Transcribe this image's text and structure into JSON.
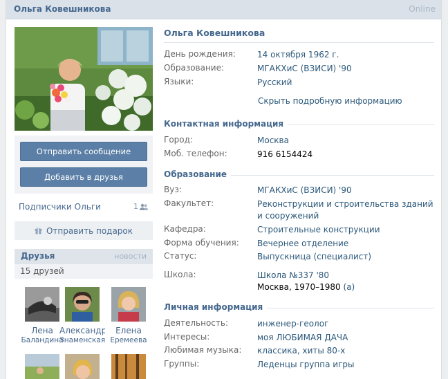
{
  "header": {
    "name": "Ольга Ковешникова",
    "status": "Online"
  },
  "actions": {
    "send_message": "Отправить сообщение",
    "add_friend": "Добавить в друзья",
    "followers_label": "Подписчики Ольги",
    "followers_count": "1",
    "send_gift": "Отправить подарок"
  },
  "friends": {
    "title": "Друзья",
    "news_link": "новости",
    "count_text": "15 друзей",
    "items": [
      {
        "first": "Лена",
        "last": "Баландина"
      },
      {
        "first": "Александрочка",
        "last": "Знаменская"
      },
      {
        "first": "Елена",
        "last": "Еремеева"
      }
    ]
  },
  "profile": {
    "name": "Ольга Ковешникова",
    "basic": [
      {
        "label": "День рождения:",
        "value": "14 октября 1962 г."
      },
      {
        "label": "Образование:",
        "value": "МГАКХиС (ВЗИСИ) '90"
      },
      {
        "label": "Языки:",
        "value": "Русский"
      }
    ],
    "hide_details": "Скрыть подробную информацию",
    "contacts": {
      "title": "Контактная информация",
      "rows": [
        {
          "label": "Город:",
          "value": "Москва"
        },
        {
          "label": "Моб. телефон:",
          "value": "916 6154424"
        }
      ]
    },
    "education": {
      "title": "Образование",
      "rows": [
        {
          "label": "Вуз:",
          "value": "МГАКХиС (ВЗИСИ) '90"
        },
        {
          "label": "Факультет:",
          "value": "Реконструкции и строительства зданий и сооружений"
        },
        {
          "label": "Кафедра:",
          "value": "Строительные конструкции"
        },
        {
          "label": "Форма обучения:",
          "value": "Вечернее отделение"
        },
        {
          "label": "Статус:",
          "value": "Выпускница (специалист)"
        }
      ],
      "school_label": "Школа:",
      "school_name": "Школа №337 '80",
      "school_details": "Москва, 1970–1980",
      "school_link": "(а)"
    },
    "personal": {
      "title": "Личная информация",
      "rows": [
        {
          "label": "Деятельность:",
          "value": "инженер-геолог"
        },
        {
          "label": "Интересы:",
          "value": "моя ЛЮБИМАЯ ДАЧА"
        },
        {
          "label": "Любимая музыка:",
          "value": "классика, хиты 80-х"
        },
        {
          "label": "Группы:",
          "value": "Леденцы группа игры"
        }
      ]
    }
  },
  "colors": {
    "link": "#2b587a",
    "title": "#45688e",
    "button": "#5b7fa6",
    "header_bg": "#dae1e8"
  },
  "icons": {
    "followers": "people-icon",
    "gift": "gift-icon"
  }
}
